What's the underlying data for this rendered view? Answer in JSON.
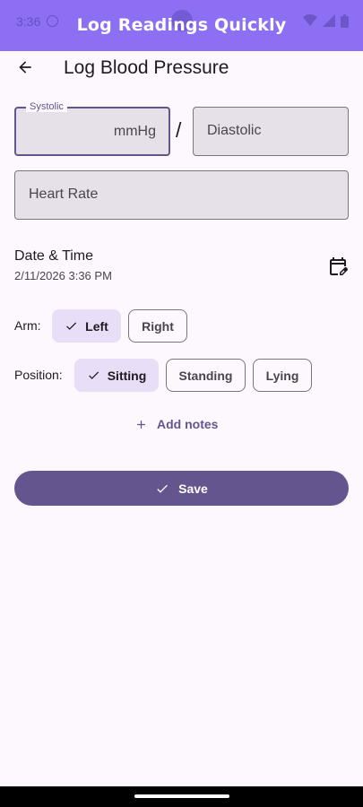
{
  "status_bar": {
    "time": "3:36"
  },
  "banner": {
    "title": "Log Readings Quickly"
  },
  "appbar": {
    "title": "Log Blood Pressure"
  },
  "systolic": {
    "label": "Systolic",
    "value": "",
    "suffix": "mmHg"
  },
  "separator": "/",
  "diastolic": {
    "label": "Diastolic",
    "value": ""
  },
  "heart_rate": {
    "label": "Heart Rate",
    "value": ""
  },
  "date_time": {
    "label": "Date & Time",
    "value": "2/11/2026 3:36 PM"
  },
  "arm": {
    "label": "Arm:",
    "options": [
      {
        "label": "Left",
        "selected": true
      },
      {
        "label": "Right",
        "selected": false
      }
    ]
  },
  "position": {
    "label": "Position:",
    "options": [
      {
        "label": "Sitting",
        "selected": true
      },
      {
        "label": "Standing",
        "selected": false
      },
      {
        "label": "Lying",
        "selected": false
      }
    ]
  },
  "add_notes": {
    "label": "Add notes"
  },
  "save": {
    "label": "Save"
  },
  "colors": {
    "banner": "#8c6ff2",
    "primary": "#65558f",
    "chip_selected": "#e8def8",
    "field_fill": "#e6e0e9",
    "background": "#fdf7fe"
  },
  "icons": {
    "back": "arrow-back-icon",
    "calendar": "edit-calendar-icon",
    "check": "check-icon",
    "add": "plus-icon"
  }
}
